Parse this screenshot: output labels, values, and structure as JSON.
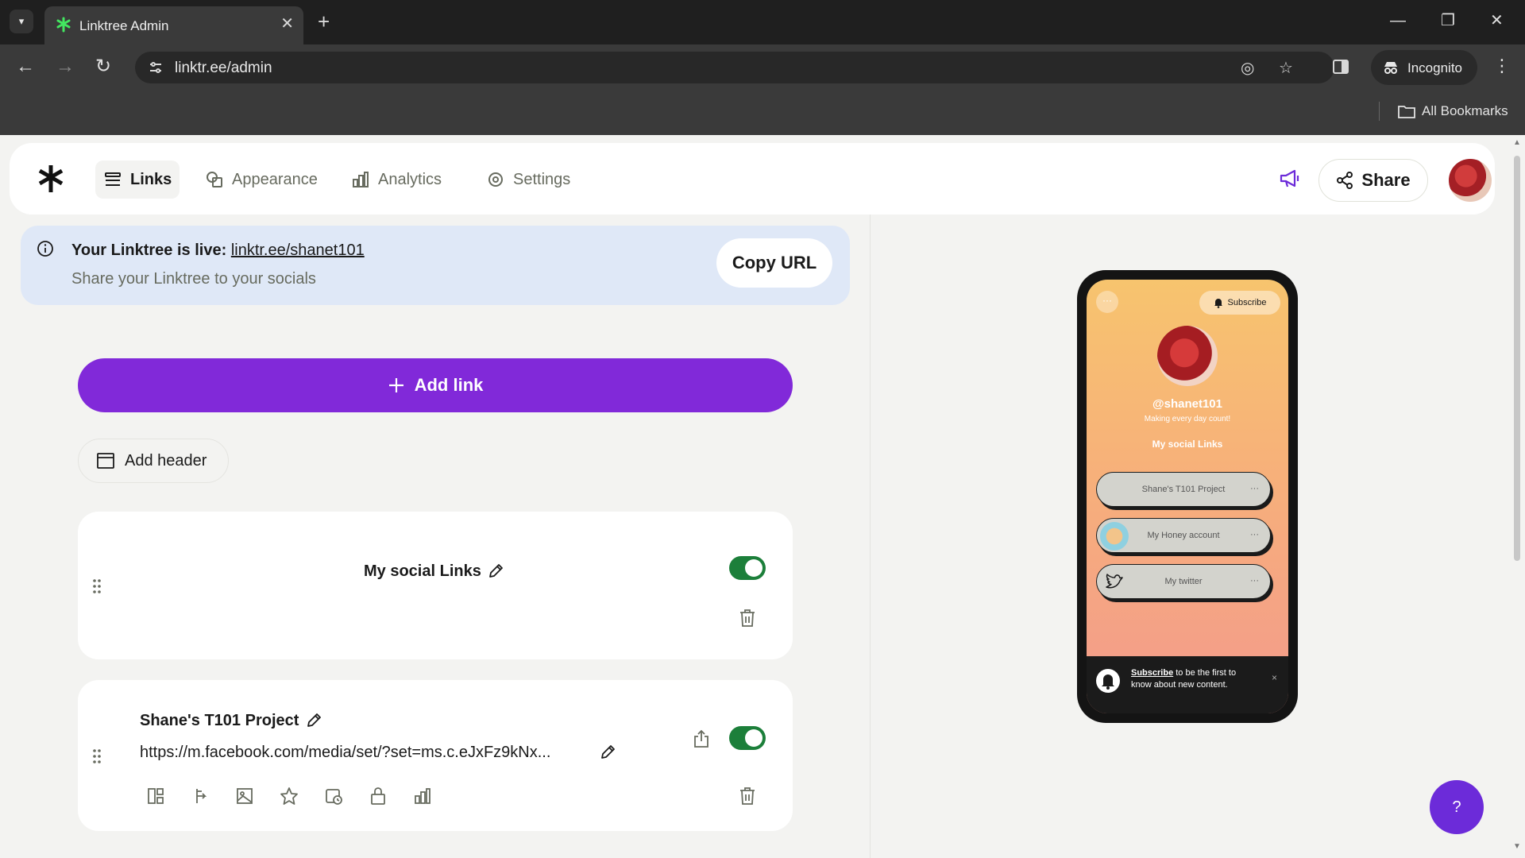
{
  "browser": {
    "tab_title": "Linktree Admin",
    "url": "linktr.ee/admin",
    "incognito_label": "Incognito",
    "all_bookmarks": "All Bookmarks"
  },
  "nav": {
    "items": [
      {
        "label": "Links"
      },
      {
        "label": "Appearance"
      },
      {
        "label": "Analytics"
      },
      {
        "label": "Settings"
      }
    ],
    "share_label": "Share"
  },
  "banner": {
    "live_prefix": "Your Linktree is live:",
    "live_url": "linktr.ee/shanet101",
    "subtitle": "Share your Linktree to your socials",
    "copy_label": "Copy URL"
  },
  "actions": {
    "add_link": "Add link",
    "add_header": "Add header"
  },
  "cards": [
    {
      "title": "My social Links",
      "enabled": true
    },
    {
      "title": "Shane's T101 Project",
      "url": "https://m.facebook.com/media/set/?set=ms.c.eJxFz9kNx...",
      "enabled": true
    }
  ],
  "preview": {
    "more": "···",
    "subscribe": "Subscribe",
    "handle": "@shanet101",
    "bio": "Making every day count!",
    "section": "My social Links",
    "links": [
      {
        "label": "Shane's T101 Project",
        "dots": "···"
      },
      {
        "label": "My Honey account",
        "dots": "···"
      },
      {
        "label": "My twitter",
        "dots": "···"
      }
    ],
    "notice_link": "Subscribe",
    "notice_text": " to be the first to know about new content.",
    "notice_close": "×"
  },
  "help_label": "?",
  "colors": {
    "brand_purple": "#8129d9",
    "toggle_green": "#1c7f3a",
    "banner_blue": "#dfe8f7"
  }
}
